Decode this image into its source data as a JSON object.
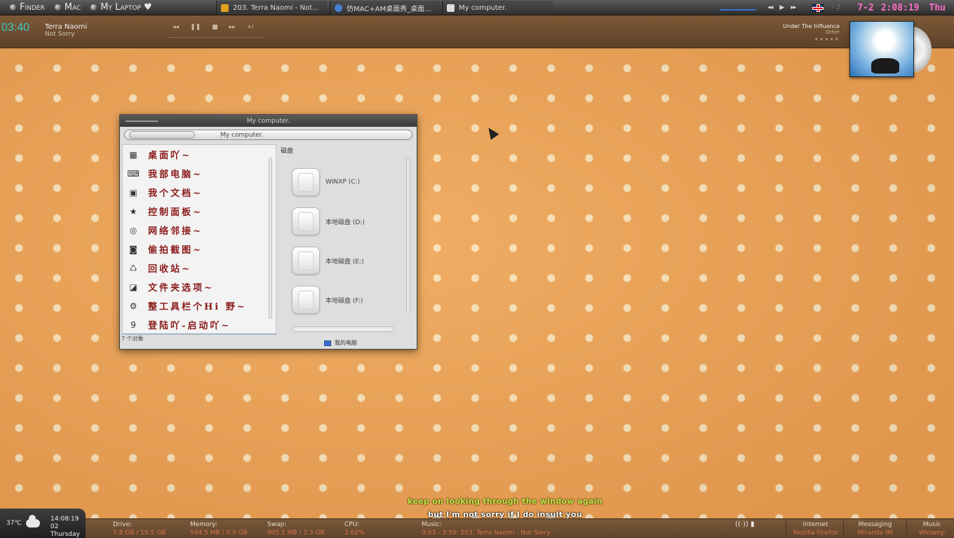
{
  "topbar": {
    "menus": [
      "Finder",
      "Mac",
      "My Laptop ♥"
    ],
    "tasks": [
      "203. Terra Naomi - Not...",
      "仿MAC+AM桌面秀_桌面...",
      "My computer."
    ],
    "clock_date": "7-2",
    "clock_time": "2:08:19",
    "clock_day": "Thu"
  },
  "music": {
    "elapsed": "03:40",
    "artist": "Terra Naomi",
    "song": "Not Sorry",
    "controls": [
      "◂◂",
      "❚❚",
      "■",
      "▸▸",
      "+i"
    ],
    "album_title": "Under The Influence",
    "album_sub": "Other",
    "rating": "★★★★★"
  },
  "window": {
    "title": "My computer.",
    "address": "My computer.",
    "left_items": [
      {
        "icon": "desktop-icon",
        "glyph": "▦",
        "label": "桌面吖~"
      },
      {
        "icon": "laptop-icon",
        "glyph": "⌨",
        "label": "我部电脑~"
      },
      {
        "icon": "briefcase-icon",
        "glyph": "▣",
        "label": "我个文档~"
      },
      {
        "icon": "star-icon",
        "glyph": "★",
        "label": "控制面板~"
      },
      {
        "icon": "network-icon",
        "glyph": "◎",
        "label": "网络邻接~"
      },
      {
        "icon": "camera-icon",
        "glyph": "◙",
        "label": "偷拍截图~"
      },
      {
        "icon": "recycle-icon",
        "glyph": "♺",
        "label": "回收站~"
      },
      {
        "icon": "folder-options-icon",
        "glyph": "◪",
        "label": "文件夹选项~"
      },
      {
        "icon": "toolbar-icon",
        "glyph": "⚙",
        "label": "整工具栏个Hi 野~"
      },
      {
        "icon": "startup-icon",
        "glyph": "9",
        "label": "登陆吖-启动吖~"
      }
    ],
    "left_status": "7 个对象",
    "right_header": "磁盘",
    "drives": [
      "WINXP (C:)",
      "本地磁盘 (D:)",
      "本地磁盘 (E:)",
      "本地磁盘 (F:)"
    ],
    "right_status": "我的电脑"
  },
  "lyrics": {
    "line1": "keep on looking through the window again",
    "line2": "but I'm not sorry if I do insult you"
  },
  "bottom": {
    "temperature": "37℃",
    "time": "14:08:19",
    "date": "02 Thursday",
    "stats": [
      {
        "label": "Drive:",
        "value": "7.8 GB  / 19.5 GB"
      },
      {
        "label": "Memory:",
        "value": "594.5 MB / 0.9 GB"
      },
      {
        "label": "Swap:",
        "value": "905.1 MB / 2.3 GB"
      },
      {
        "label": "CPU:",
        "value": "3.62%"
      },
      {
        "label": "Music:",
        "value": "0:03 - 3:50: 203. Terra Naomi - Not Sorry"
      }
    ],
    "apps": [
      {
        "label": "Internet",
        "value": "Mozilla Firefox"
      },
      {
        "label": "Messaging",
        "value": "Miranda IM"
      },
      {
        "label": "Music",
        "value": "Winamp"
      }
    ]
  },
  "colors": {
    "lyric_top": "#c7e24a",
    "clock": "#ff6ec7",
    "elapsed": "#3cc6c8",
    "menu_label": "#8b1a1a"
  }
}
